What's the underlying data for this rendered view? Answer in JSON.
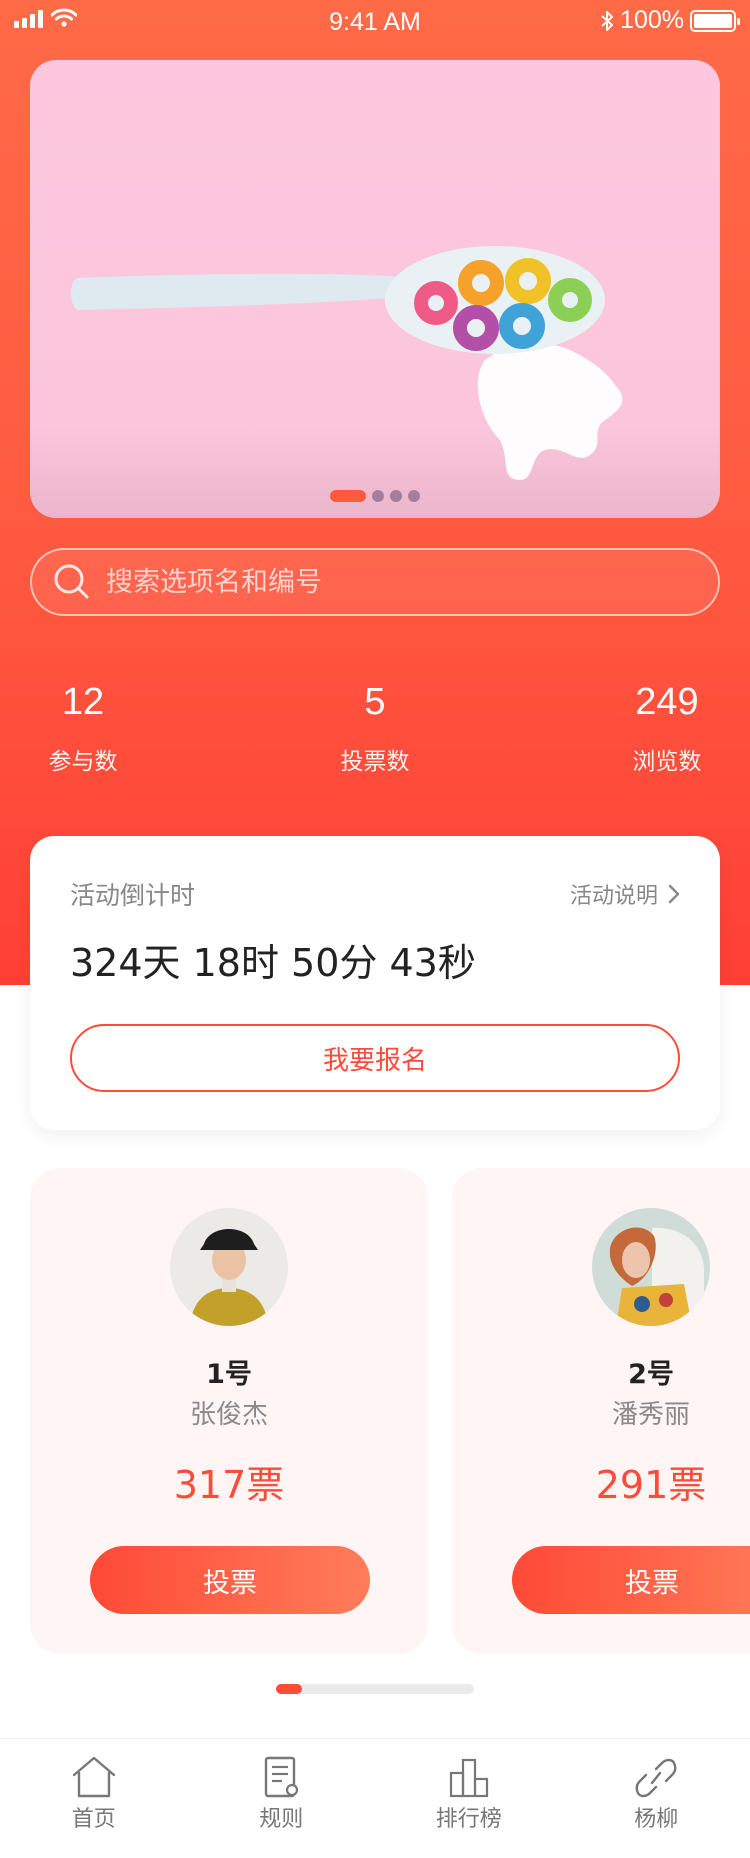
{
  "status_bar": {
    "time": "9:41 AM",
    "battery": "100%"
  },
  "banner": {
    "slide_count": 4,
    "active_index": 0
  },
  "search": {
    "placeholder": "搜索选项名和编号"
  },
  "stats": [
    {
      "value": "12",
      "label": "参与数"
    },
    {
      "value": "5",
      "label": "投票数"
    },
    {
      "value": "249",
      "label": "浏览数"
    }
  ],
  "countdown": {
    "title": "活动倒计时",
    "link": "活动说明",
    "value": "324天 18时 50分 43秒",
    "signup_label": "我要报名"
  },
  "candidates": [
    {
      "number": "1号",
      "name": "张俊杰",
      "votes": "317票",
      "vote_label": "投票"
    },
    {
      "number": "2号",
      "name": "潘秀丽",
      "votes": "291票",
      "vote_label": "投票"
    }
  ],
  "tabbar": [
    {
      "label": "首页",
      "icon": "home-icon"
    },
    {
      "label": "规则",
      "icon": "rules-icon"
    },
    {
      "label": "排行榜",
      "icon": "ranking-icon"
    },
    {
      "label": "杨柳",
      "icon": "link-icon"
    }
  ],
  "colors": {
    "accent": "#ff4b3a",
    "header_gradient_start": "#ff6a47",
    "header_gradient_end": "#ff3f36",
    "banner_bg": "#fcc7dd"
  }
}
